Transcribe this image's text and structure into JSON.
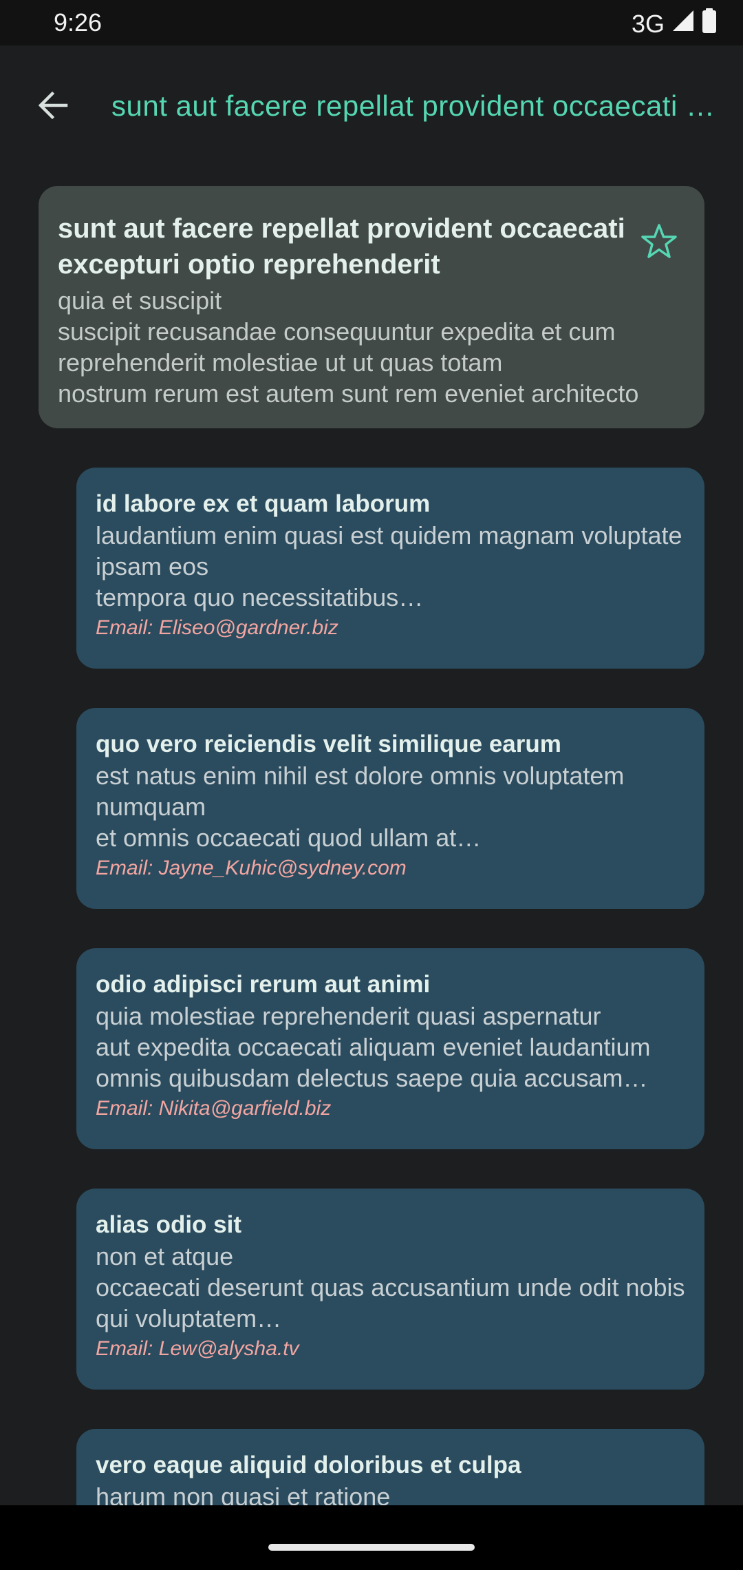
{
  "status_bar": {
    "time": "9:26",
    "network": "3G",
    "icons": [
      "signal-icon",
      "battery-icon"
    ]
  },
  "app_bar": {
    "back_icon": "arrow-left-icon",
    "title": "sunt aut facere repellat provident occaecati excepturi optio reprehenderit",
    "accent_color": "#56d7b3"
  },
  "post": {
    "title": "sunt aut facere repellat provident occaecati excepturi optio reprehenderit",
    "body": "quia et suscipit\nsuscipit recusandae consequuntur expedita et cum reprehenderit molestiae ut ut quas totam\nnostrum rerum est autem sunt rem eveniet architecto",
    "favorite_icon": "star-outline-icon"
  },
  "comments": [
    {
      "name": "id labore ex et quam laborum",
      "body": "laudantium enim quasi est quidem magnam voluptate ipsam eos\ntempora quo necessitatibus…",
      "email": "Email: Eliseo@gardner.biz"
    },
    {
      "name": "quo vero reiciendis velit similique earum",
      "body": "est natus enim nihil est dolore omnis voluptatem numquam\net omnis occaecati quod ullam at…",
      "email": "Email: Jayne_Kuhic@sydney.com"
    },
    {
      "name": "odio adipisci rerum aut animi",
      "body": "quia molestiae reprehenderit quasi aspernatur\naut expedita occaecati aliquam eveniet laudantium\nomnis quibusdam delectus saepe quia accusam…",
      "email": "Email: Nikita@garfield.biz"
    },
    {
      "name": "alias odio sit",
      "body": "non et atque\noccaecati deserunt quas accusantium unde odit nobis qui voluptatem…",
      "email": "Email: Lew@alysha.tv"
    },
    {
      "name": "vero eaque aliquid doloribus et culpa",
      "body": "harum non quasi et ratione",
      "email": ""
    }
  ],
  "colors": {
    "background": "#1c1e1f",
    "post_card": "#414a47",
    "comment_card": "#2b4b5e",
    "email_text": "#f3a6a1"
  }
}
